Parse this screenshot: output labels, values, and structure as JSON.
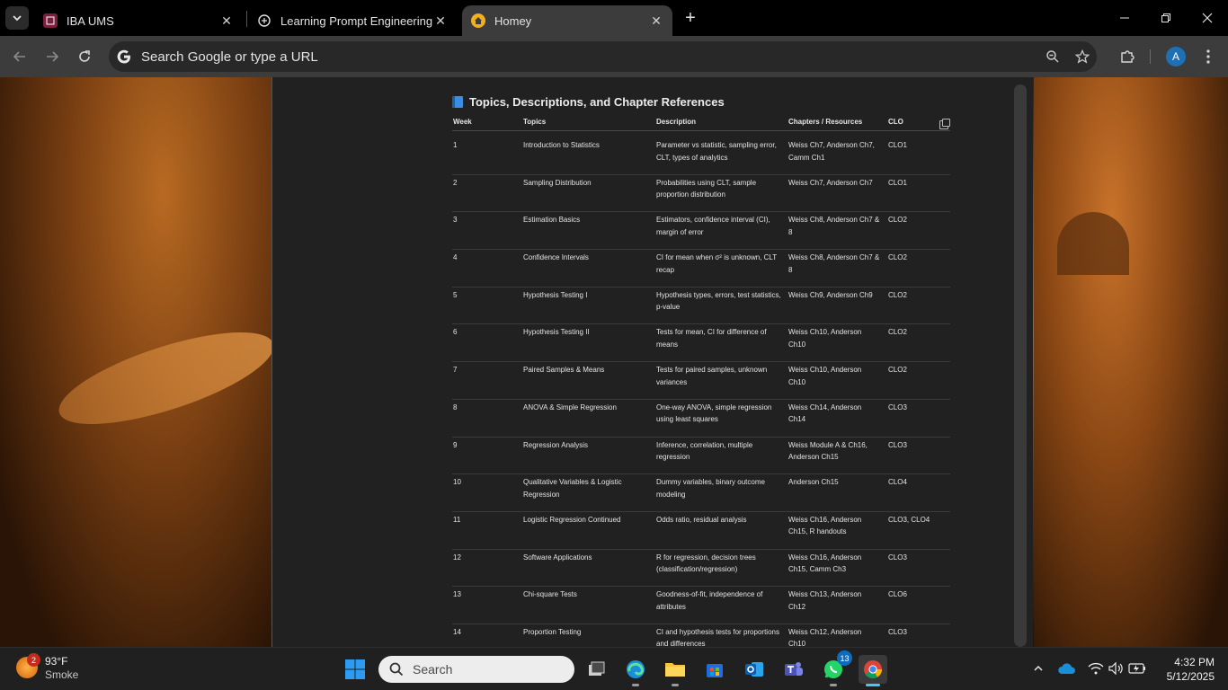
{
  "browser": {
    "tabs": [
      {
        "title": "IBA UMS",
        "active": false
      },
      {
        "title": "Learning Prompt Engineering -",
        "active": false
      },
      {
        "title": "Homey",
        "active": true
      }
    ],
    "omnibox_placeholder": "Search Google or type a URL",
    "profile_initial": "A"
  },
  "page": {
    "heading": "Topics, Descriptions, and Chapter References",
    "columns": [
      "Week",
      "Topics",
      "Description",
      "Chapters / Resources",
      "CLO"
    ],
    "rows": [
      {
        "week": "1",
        "topic": "Introduction to Statistics",
        "desc": "Parameter vs statistic, sampling error, CLT, types of analytics",
        "chapters": "Weiss Ch7, Anderson Ch7, Camm Ch1",
        "clo": "CLO1"
      },
      {
        "week": "2",
        "topic": "Sampling Distribution",
        "desc": "Probabilities using CLT, sample proportion distribution",
        "chapters": "Weiss Ch7, Anderson Ch7",
        "clo": "CLO1"
      },
      {
        "week": "3",
        "topic": "Estimation Basics",
        "desc": "Estimators, confidence interval (CI), margin of error",
        "chapters": "Weiss Ch8, Anderson Ch7 & 8",
        "clo": "CLO2"
      },
      {
        "week": "4",
        "topic": "Confidence Intervals",
        "desc": "CI for mean when σ² is unknown, CLT recap",
        "chapters": "Weiss Ch8, Anderson Ch7 & 8",
        "clo": "CLO2"
      },
      {
        "week": "5",
        "topic": "Hypothesis Testing I",
        "desc": "Hypothesis types, errors, test statistics, p-value",
        "chapters": "Weiss Ch9, Anderson Ch9",
        "clo": "CLO2"
      },
      {
        "week": "6",
        "topic": "Hypothesis Testing II",
        "desc": "Tests for mean, CI for difference of means",
        "chapters": "Weiss Ch10, Anderson Ch10",
        "clo": "CLO2"
      },
      {
        "week": "7",
        "topic": "Paired Samples & Means",
        "desc": "Tests for paired samples, unknown variances",
        "chapters": "Weiss Ch10, Anderson Ch10",
        "clo": "CLO2"
      },
      {
        "week": "8",
        "topic": "ANOVA & Simple Regression",
        "desc": "One-way ANOVA, simple regression using least squares",
        "chapters": "Weiss Ch14, Anderson Ch14",
        "clo": "CLO3"
      },
      {
        "week": "9",
        "topic": "Regression Analysis",
        "desc": "Inference, correlation, multiple regression",
        "chapters": "Weiss Module A & Ch16, Anderson Ch15",
        "clo": "CLO3"
      },
      {
        "week": "10",
        "topic": "Qualitative Variables & Logistic Regression",
        "desc": "Dummy variables, binary outcome modeling",
        "chapters": "Anderson Ch15",
        "clo": "CLO4"
      },
      {
        "week": "11",
        "topic": "Logistic Regression Continued",
        "desc": "Odds ratio, residual analysis",
        "chapters": "Weiss Ch16, Anderson Ch15, R handouts",
        "clo": "CLO3, CLO4"
      },
      {
        "week": "12",
        "topic": "Software Applications",
        "desc": "R for regression, decision trees (classification/regression)",
        "chapters": "Weiss Ch16, Anderson Ch15, Camm Ch3",
        "clo": "CLO3"
      },
      {
        "week": "13",
        "topic": "Chi-square Tests",
        "desc": "Goodness-of-fit, independence of attributes",
        "chapters": "Weiss Ch13, Anderson Ch12",
        "clo": "CLO6"
      },
      {
        "week": "14",
        "topic": "Proportion Testing",
        "desc": "CI and hypothesis tests for proportions and differences",
        "chapters": "Weiss Ch12, Anderson Ch10",
        "clo": "CLO3"
      }
    ]
  },
  "taskbar": {
    "weather_temp": "93°F",
    "weather_cond": "Smoke",
    "weather_badge": "2",
    "search_label": "Search",
    "whatsapp_badge": "13",
    "time": "4:32 PM",
    "date": "5/12/2025"
  },
  "colors": {
    "panel": "#212121",
    "toolbar": "#3c3c3c",
    "accent": "#4cc2ff"
  }
}
